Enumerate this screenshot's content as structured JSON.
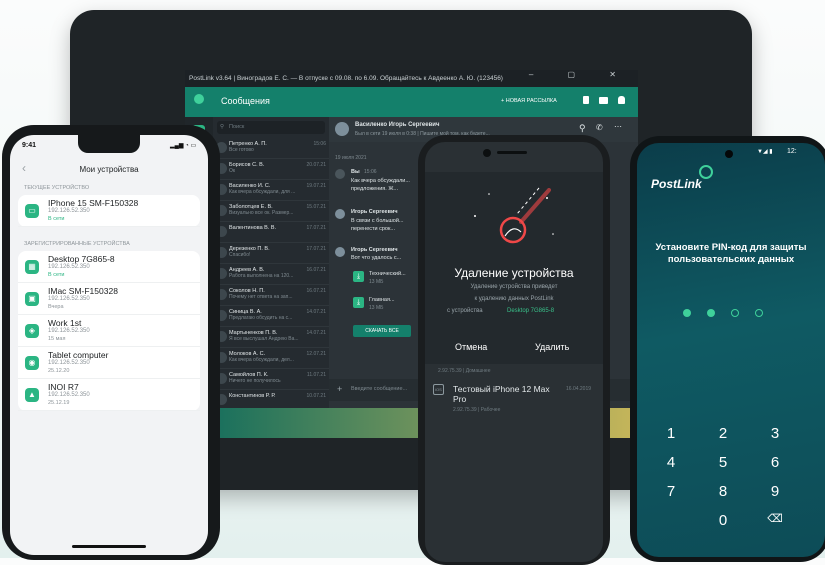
{
  "desktop": {
    "title_bar": "PostLink v3.64  |  Виноградов Е. С. — В отпуске с 09.08. по 6.09. Обращайтесь к Авдеенко А. Ю. (123456)",
    "app_title": "Сообщения",
    "new_broadcast": "+ НОВАЯ РАССЫЛКА",
    "search_placeholder": "Поиск",
    "chats": [
      {
        "name": "Петренко А. П.",
        "preview": "Все готово",
        "date": "15:06"
      },
      {
        "name": "Борисов С. В.",
        "preview": "Ок",
        "date": "20.07.21"
      },
      {
        "name": "Василенко И. С.",
        "preview": "Как вчера обсуждали, для ...",
        "date": "19.07.21"
      },
      {
        "name": "Заболотцев Е. В.",
        "preview": "Визуально все ок. Размер...",
        "date": "15.07.21"
      },
      {
        "name": "Валентинова В. В.",
        "preview": "",
        "date": "17.07.21"
      },
      {
        "name": "Дерезенко П. В.",
        "preview": "Спасибо!",
        "date": "17.07.21"
      },
      {
        "name": "Андреев А. В.",
        "preview": "Работа выполнена на 120...",
        "date": "16.07.21"
      },
      {
        "name": "Соколов Н. П.",
        "preview": "Почему нет ответа на зап...",
        "date": "16.07.21"
      },
      {
        "name": "Синица В. А.",
        "preview": "Предлагаю обсудить на с...",
        "date": "14.07.21"
      },
      {
        "name": "Мартыненков П. В.",
        "preview": "Я все выслушал Андрею Ва...",
        "date": "14.07.21"
      },
      {
        "name": "Молоков А. С.",
        "preview": "Как вчера обсуждали, дел...",
        "date": "12.07.21"
      },
      {
        "name": "Самойлов П. К.",
        "preview": "Ничего не получилось",
        "date": "11.07.21"
      },
      {
        "name": "Константинов Р. Р.",
        "preview": "",
        "date": "10.07.21"
      }
    ],
    "contact_name": "Василенко Игорь Сергеевич",
    "contact_status": "Был в сети 19 июля в 0:38  |  Пишите мой том, как будете...",
    "date_divider": "19 июля 2021",
    "messages": [
      {
        "author": "Вы",
        "time": "15:06",
        "text": "Как вчера обсуждали...",
        "text2": "предложения. Ж..."
      },
      {
        "author": "Игорь Сергеевич",
        "time": "",
        "text": "В связи с большой...",
        "text2": "перенести срок..."
      },
      {
        "author": "Игорь Сергеевич",
        "time": "",
        "text": "Вот что удалось с...",
        "text2": ""
      }
    ],
    "files": [
      {
        "name": "Технический...",
        "size": "13 МБ"
      },
      {
        "name": "Главная...",
        "size": "13 МБ"
      }
    ],
    "download_all": "СКАЧАТЬ ВСЕ",
    "input_placeholder": "Введите сообщение..."
  },
  "left_phone": {
    "time": "9:41",
    "title": "Мои устройства",
    "current_label": "ТЕКУЩЕЕ УСТРОЙСТВО",
    "current": {
      "name": "IPhone 15 SM-F150328",
      "ip": "192.126.52.350",
      "status": "В сети"
    },
    "registered_label": "ЗАРЕГИСТРИРОВАННЫЕ УСТРОЙСТВА",
    "devices": [
      {
        "name": "Desktop 7G865-8",
        "ip": "192.126.52.350",
        "status": "В сети",
        "icon": "desktop-icon"
      },
      {
        "name": "IMac SM-F150328",
        "ip": "192.126.52.350",
        "status": "Вчера",
        "icon": "imac-icon"
      },
      {
        "name": "Work 1st",
        "ip": "192.126.52.350",
        "status": "15 мая",
        "icon": "work-icon"
      },
      {
        "name": "Tablet computer",
        "ip": "192.126.52.350",
        "status": "25.12.20",
        "icon": "tablet-icon"
      },
      {
        "name": "INOI R7",
        "ip": "192.126.52.350",
        "status": "25.12.19",
        "icon": "android-icon"
      }
    ]
  },
  "middle_phone": {
    "dialog_title": "Удаление устройства",
    "dialog_text1": "Удаление устройства приведет",
    "dialog_text2": "к удалению данных PostLink",
    "dialog_text3": "с устройства",
    "dialog_device": "Desktop 7G865-8",
    "cancel": "Отмена",
    "delete": "Удалить",
    "below_ip": "2.92.75.39  |  Домашнее",
    "below_device": "Тестовый iPhone 12 Max Pro",
    "below_date": "16.04.2019",
    "below_ip2": "2.92.75.39  |  Рабочее"
  },
  "right_phone": {
    "time": "12:",
    "brand": "PostLink",
    "prompt": "Установите PIN-код для защиты пользовательских данных",
    "pin_filled": 2,
    "pin_length": 4,
    "keys": [
      "1",
      "2",
      "3",
      "4",
      "5",
      "6",
      "7",
      "8",
      "9",
      "0"
    ]
  },
  "colors": {
    "accent": "#14806b",
    "green": "#2bb583",
    "link": "#39c08a"
  }
}
